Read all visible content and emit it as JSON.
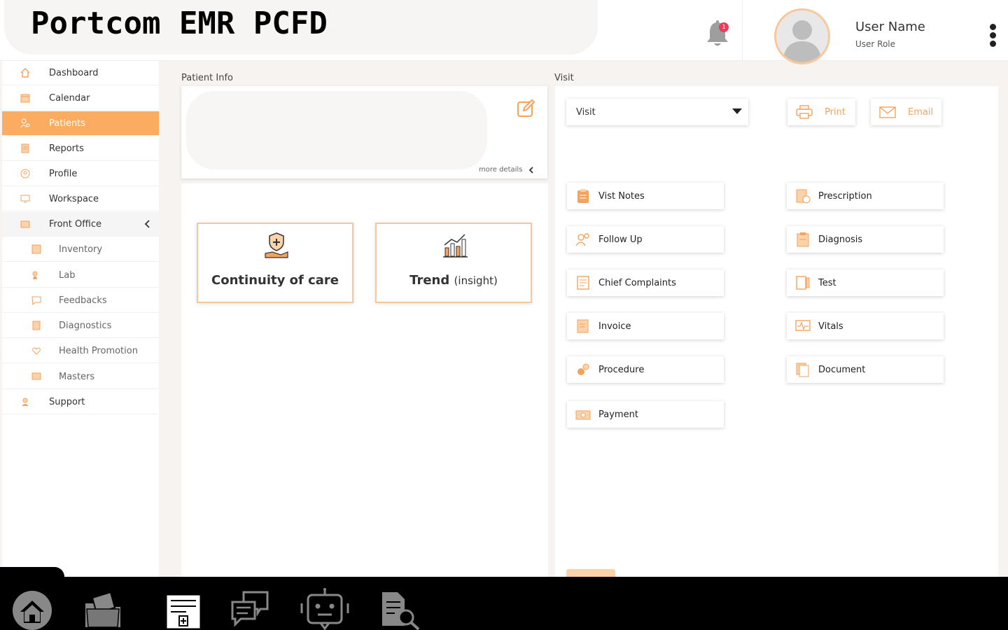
{
  "app_title": "Portcom EMR PCFD",
  "notifications": {
    "count": "1"
  },
  "user": {
    "name": "User Name",
    "role": "User Role"
  },
  "sidebar": {
    "items": [
      {
        "label": "Dashboard",
        "icon": "home-icon"
      },
      {
        "label": "Calendar",
        "icon": "calendar-icon"
      },
      {
        "label": "Patients",
        "icon": "patients-icon",
        "active": true
      },
      {
        "label": "Reports",
        "icon": "reports-icon"
      },
      {
        "label": "Profile",
        "icon": "profile-icon"
      },
      {
        "label": "Workspace",
        "icon": "workspace-icon"
      },
      {
        "label": "Front Office",
        "icon": "front-office-icon",
        "expanded": true
      },
      {
        "label": "Inventory",
        "icon": "inventory-icon"
      },
      {
        "label": "Lab",
        "icon": "lab-icon"
      },
      {
        "label": "Feedbacks",
        "icon": "feedback-icon"
      },
      {
        "label": "Diagnostics",
        "icon": "diagnostics-icon"
      },
      {
        "label": "Health Promotion",
        "icon": "health-promotion-icon"
      },
      {
        "label": "Masters",
        "icon": "masters-icon"
      },
      {
        "label": "Support",
        "icon": "support-icon"
      }
    ]
  },
  "patient_info": {
    "section_label": "Patient Info",
    "more_details": "more details"
  },
  "features": [
    {
      "title": "Continuity of care",
      "suffix": "",
      "icon": "hand-shield-icon"
    },
    {
      "title": "Trend",
      "suffix": "(insight)",
      "icon": "bar-chart-icon"
    }
  ],
  "visit": {
    "section_label": "Visit",
    "select_value": "Visit",
    "print_label": "Print",
    "email_label": "Email",
    "tiles": [
      {
        "label": "Vist Notes",
        "icon": "clipboard-icon"
      },
      {
        "label": "Prescription",
        "icon": "prescription-icon"
      },
      {
        "label": "Follow Up",
        "icon": "follow-up-icon"
      },
      {
        "label": "Diagnosis",
        "icon": "diagnosis-icon"
      },
      {
        "label": "Chief Complaints",
        "icon": "complaints-icon"
      },
      {
        "label": "Test",
        "icon": "test-icon"
      },
      {
        "label": "Invoice",
        "icon": "invoice-icon"
      },
      {
        "label": "Vitals",
        "icon": "vitals-icon"
      },
      {
        "label": "Procedure",
        "icon": "procedure-icon"
      },
      {
        "label": "Document",
        "icon": "document-icon"
      },
      {
        "label": "Payment",
        "icon": "payment-icon"
      }
    ]
  },
  "dock": [
    {
      "icon": "home-icon"
    },
    {
      "icon": "folder-icon"
    },
    {
      "icon": "medical-record-icon"
    },
    {
      "icon": "chat-icon"
    },
    {
      "icon": "robot-icon"
    },
    {
      "icon": "document-search-icon"
    }
  ],
  "colors": {
    "accent": "#fbac61",
    "accent_text": "#f5a25d",
    "badge": "#ef3b5b"
  }
}
